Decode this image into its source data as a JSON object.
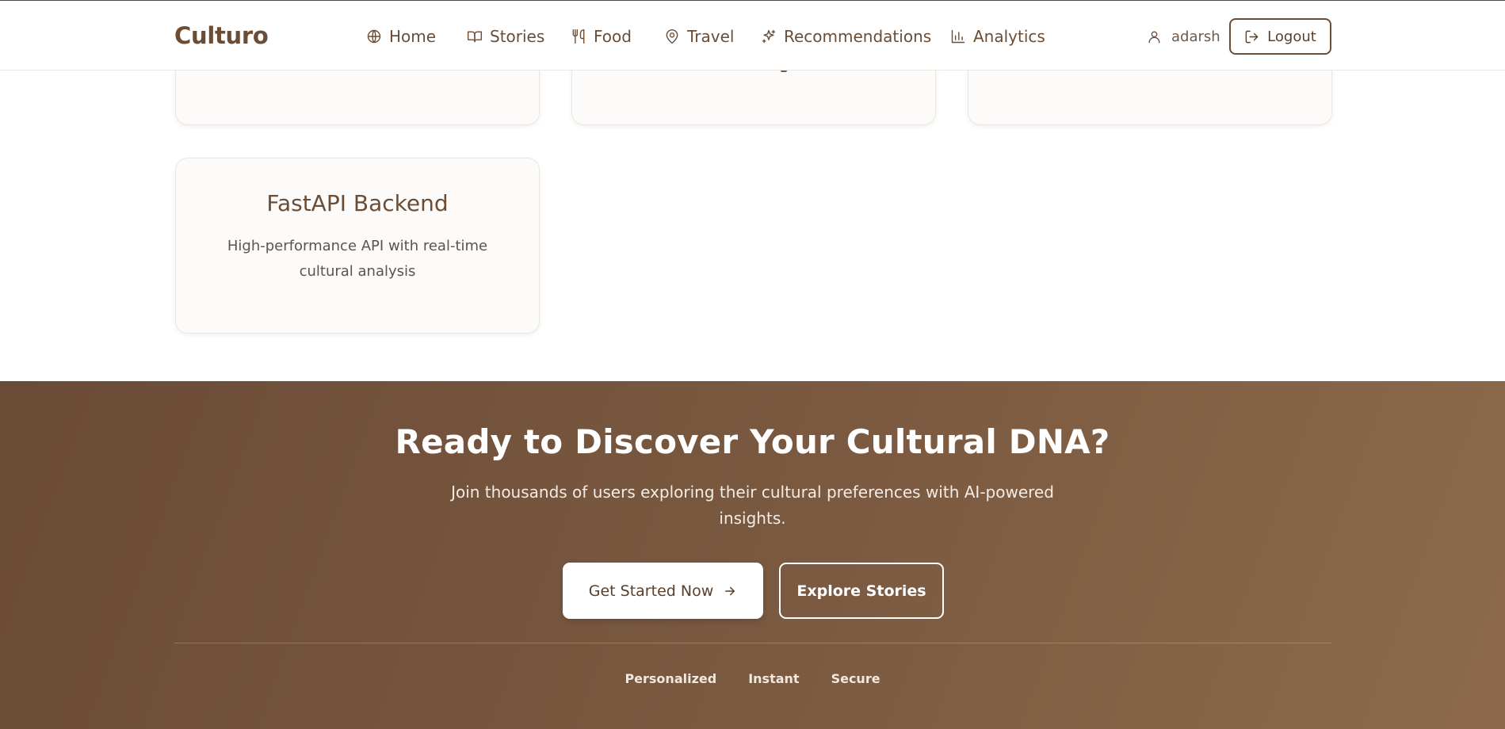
{
  "header": {
    "brand": "Culturo",
    "nav": [
      {
        "label": "Home",
        "icon": "globe-icon"
      },
      {
        "label": "Stories",
        "icon": "book-icon"
      },
      {
        "label": "Food",
        "icon": "utensils-icon"
      },
      {
        "label": "Travel",
        "icon": "map-pin-icon"
      },
      {
        "label": "Recommendations",
        "icon": "sparkles-icon"
      },
      {
        "label": "Analytics",
        "icon": "bar-chart-icon"
      }
    ],
    "user": {
      "name": "adarsh",
      "icon": "user-icon"
    },
    "logout_label": "Logout"
  },
  "features": {
    "fastapi": {
      "title": "FastAPI Backend",
      "description": "High-performance API with real-time cultural analysis"
    }
  },
  "cta": {
    "title": "Ready to Discover Your Cultural DNA?",
    "subtitle": "Join thousands of users exploring their cultural preferences with AI-powered insights.",
    "primary_label": "Get Started Now",
    "secondary_label": "Explore Stories",
    "tags": [
      "Personalized",
      "Instant",
      "Secure"
    ]
  },
  "colors": {
    "brand": "#6b4d36",
    "cta_gradient_start": "#6a4b36",
    "cta_gradient_end": "#8c6a4b",
    "card_bg": "#fcfbf9"
  }
}
